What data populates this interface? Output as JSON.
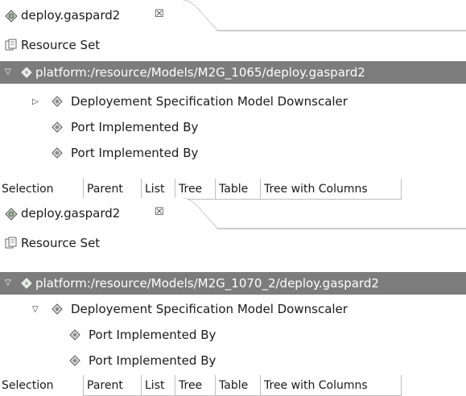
{
  "editors": [
    {
      "tab_title": "deploy.gaspard2",
      "tab_close_glyph": "☒",
      "resource_set": "Resource Set",
      "resource_uri": "platform:/resource/Models/M2G_1065/deploy.gaspard2",
      "root_expanded": true,
      "child": {
        "label": "Deployement Specification Model Downscaler",
        "expanded": false,
        "ports": [
          "Port Implemented By",
          "Port Implemented By"
        ]
      },
      "view_tabs": [
        "Selection",
        "Parent",
        "List",
        "Tree",
        "Table",
        "Tree with Columns"
      ],
      "active_view_tab": "Selection"
    },
    {
      "tab_title": "deploy.gaspard2",
      "tab_close_glyph": "☒",
      "resource_set": "Resource Set",
      "resource_uri": "platform:/resource/Models/M2G_1070_2/deploy.gaspard2",
      "root_expanded": true,
      "child": {
        "label": "Deployement Specification Model Downscaler",
        "expanded": true,
        "ports": [
          "Port Implemented By",
          "Port Implemented By"
        ]
      },
      "view_tabs": [
        "Selection",
        "Parent",
        "List",
        "Tree",
        "Table",
        "Tree with Columns"
      ],
      "active_view_tab": "Selection"
    }
  ],
  "icons": {
    "editor_tab": "gaspard-model-icon",
    "resource_set": "resource-set-icon",
    "model_node": "model-element-icon",
    "tree_collapsed": "tree-collapsed-triangle",
    "tree_expanded": "tree-expanded-triangle"
  },
  "colors": {
    "selection_bg": "#7c7c7c",
    "selection_fg": "#ffffff"
  }
}
